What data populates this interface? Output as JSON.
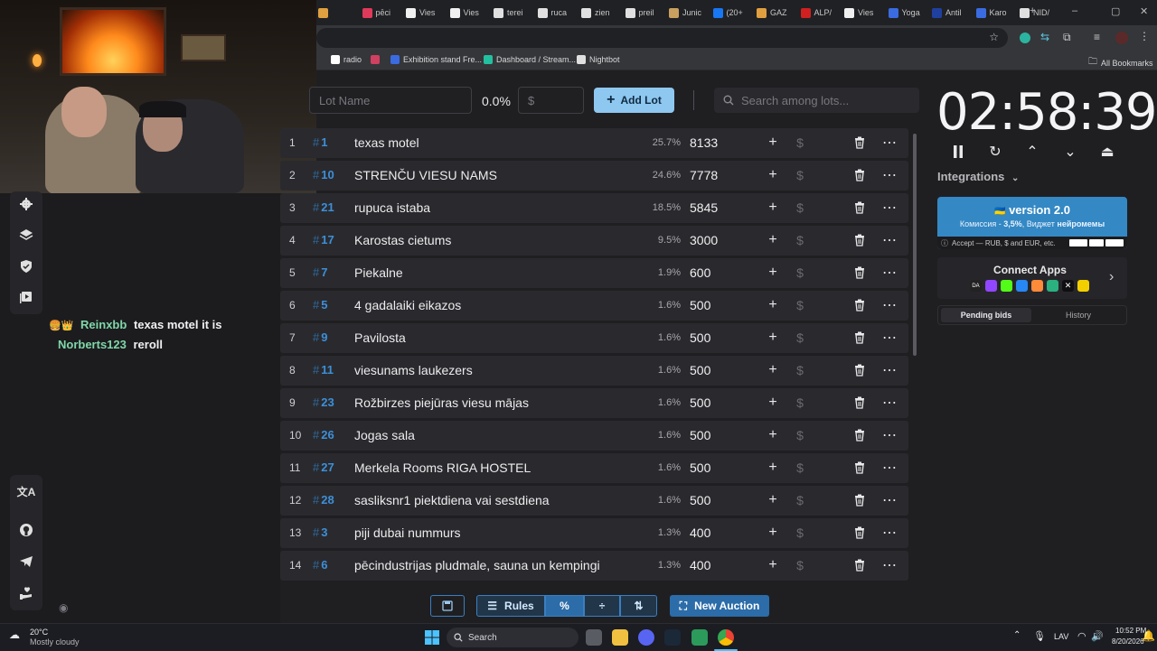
{
  "browser": {
    "tabs": [
      {
        "label": "",
        "color": "#e0a040"
      },
      {
        "label": "pēci",
        "color": "#e03a5a"
      },
      {
        "label": "Vies",
        "color": "#f0f0f0"
      },
      {
        "label": "Vies",
        "color": "#f0f0f0"
      },
      {
        "label": "terei",
        "color": "#e0e0e0"
      },
      {
        "label": "ruca",
        "color": "#e0e0e0"
      },
      {
        "label": "zien",
        "color": "#e0e0e0"
      },
      {
        "label": "preil",
        "color": "#e0e0e0"
      },
      {
        "label": "Junic",
        "color": "#c9a060"
      },
      {
        "label": "(20+",
        "color": "#1877f2"
      },
      {
        "label": "GAZ",
        "color": "#e0a040"
      },
      {
        "label": "ALP/",
        "color": "#d02020"
      },
      {
        "label": "Vies",
        "color": "#f0f0f0"
      },
      {
        "label": "Yoga",
        "color": "#3a6be0"
      },
      {
        "label": "Antil",
        "color": "#2040a0"
      },
      {
        "label": "Karo",
        "color": "#3a6be0"
      },
      {
        "label": "NID/",
        "color": "#e0e0e0"
      }
    ],
    "new_tab": "+",
    "window_controls": {
      "minimize": "–",
      "maximize": "▢",
      "close": "✕"
    },
    "bookmarks": [
      {
        "label": "radio",
        "color": "#ffffff"
      },
      {
        "label": "",
        "color": "#d04060"
      },
      {
        "label": "Exhibition stand Fre...",
        "color": "#3a6be0"
      },
      {
        "label": "Dashboard / Stream...",
        "color": "#22c0a0"
      },
      {
        "label": "Nightbot",
        "color": "#e0e0e0"
      }
    ],
    "all_bookmarks": "All Bookmarks"
  },
  "chat": {
    "messages": [
      {
        "user": "Reinxbb",
        "user_color": "#7fd7a8",
        "text": "texas motel it is"
      },
      {
        "user": "Norberts123",
        "user_color": "#7fd7a8",
        "text": "reroll"
      }
    ]
  },
  "toolbar": {
    "lot_name_placeholder": "Lot Name",
    "percent": "0.0%",
    "amount_placeholder": "$",
    "add_lot_label": "Add Lot",
    "search_placeholder": "Search among lots..."
  },
  "lots": [
    {
      "num": "1",
      "id": "1",
      "name": "texas motel",
      "pct": "25.7%",
      "amount": "8133"
    },
    {
      "num": "2",
      "id": "10",
      "name": "STRENČU VIESU NAMS",
      "pct": "24.6%",
      "amount": "7778"
    },
    {
      "num": "3",
      "id": "21",
      "name": "rupuca istaba",
      "pct": "18.5%",
      "amount": "5845"
    },
    {
      "num": "4",
      "id": "17",
      "name": "Karostas cietums",
      "pct": "9.5%",
      "amount": "3000"
    },
    {
      "num": "5",
      "id": "7",
      "name": "Piekalne",
      "pct": "1.9%",
      "amount": "600"
    },
    {
      "num": "6",
      "id": "5",
      "name": "4 gadalaiki eikazos",
      "pct": "1.6%",
      "amount": "500"
    },
    {
      "num": "7",
      "id": "9",
      "name": "Pavilosta",
      "pct": "1.6%",
      "amount": "500"
    },
    {
      "num": "8",
      "id": "11",
      "name": " viesunams laukezers",
      "pct": "1.6%",
      "amount": "500"
    },
    {
      "num": "9",
      "id": "23",
      "name": "Rožbirzes piejūras viesu mājas",
      "pct": "1.6%",
      "amount": "500"
    },
    {
      "num": "10",
      "id": "26",
      "name": "Jogas sala",
      "pct": "1.6%",
      "amount": "500"
    },
    {
      "num": "11",
      "id": "27",
      "name": " Merkela Rooms RIGA HOSTEL",
      "pct": "1.6%",
      "amount": "500"
    },
    {
      "num": "12",
      "id": "28",
      "name": " sasliksnr1 piektdiena vai sestdiena",
      "pct": "1.6%",
      "amount": "500"
    },
    {
      "num": "13",
      "id": "3",
      "name": "piji dubai nummurs",
      "pct": "1.3%",
      "amount": "400"
    },
    {
      "num": "14",
      "id": "6",
      "name": "pēcindustrijas pludmale, sauna un kempingi",
      "pct": "1.3%",
      "amount": "400"
    }
  ],
  "bottom_toolbar": {
    "rules_label": "Rules",
    "new_auction_label": "New Auction"
  },
  "timer": {
    "value": "02:58:39"
  },
  "integrations": {
    "label": "Integrations"
  },
  "promo": {
    "title": "version 2.0",
    "subtitle_prefix": "Комиссия - ",
    "subtitle_rate": "3,5%",
    "subtitle_mid": ", Виджет ",
    "subtitle_end": "нейромемы",
    "footer": "Accept — RUB, $ and EUR, etc."
  },
  "connect_apps": {
    "label": "Connect Apps"
  },
  "bid_tabs": {
    "pending": "Pending bids",
    "history": "History"
  },
  "taskbar": {
    "weather_temp": "20°C",
    "weather_desc": "Mostly cloudy",
    "search_label": "Search",
    "language": "LAV",
    "time": "10:52 PM",
    "date": "8/20/2026"
  },
  "colors": {
    "accent": "#3d8fd8",
    "add_button": "#8ec7f0",
    "promo_bg": "#3488c4"
  }
}
